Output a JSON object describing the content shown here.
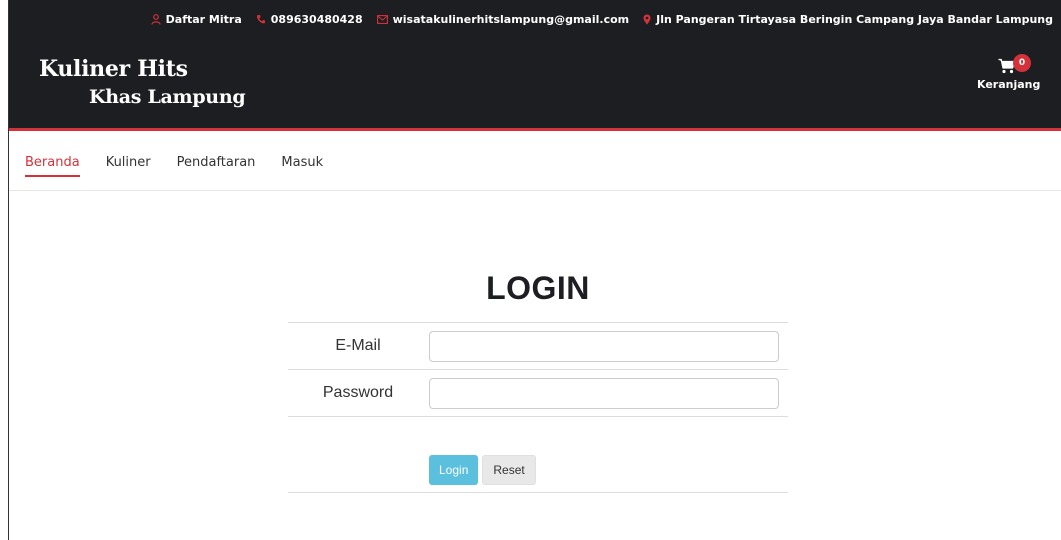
{
  "topbar": {
    "partner": "Daftar Mitra",
    "phone": "089630480428",
    "email": "wisatakulinerhitslampung@gmail.com",
    "address": "Jln Pangeran Tirtayasa Beringin Campang Jaya Bandar Lampung"
  },
  "brand": {
    "line1": "Kuliner Hits",
    "line2": "Khas Lampung"
  },
  "cart": {
    "count": "0",
    "label": "Keranjang"
  },
  "nav": {
    "items": [
      "Beranda",
      "Kuliner",
      "Pendaftaran",
      "Masuk"
    ]
  },
  "login": {
    "title": "LOGIN",
    "email_label": "E-Mail",
    "email_value": "",
    "password_label": "Password",
    "password_value": "",
    "login_button": "Login",
    "reset_button": "Reset"
  },
  "colors": {
    "accent": "#d3323a",
    "dark": "#1d1e22",
    "login_button": "#5bc0de"
  },
  "icons": {
    "partner": "user-icon",
    "phone": "phone-icon",
    "email": "envelope-icon",
    "address": "map-marker-icon",
    "cart": "shopping-cart-icon"
  }
}
